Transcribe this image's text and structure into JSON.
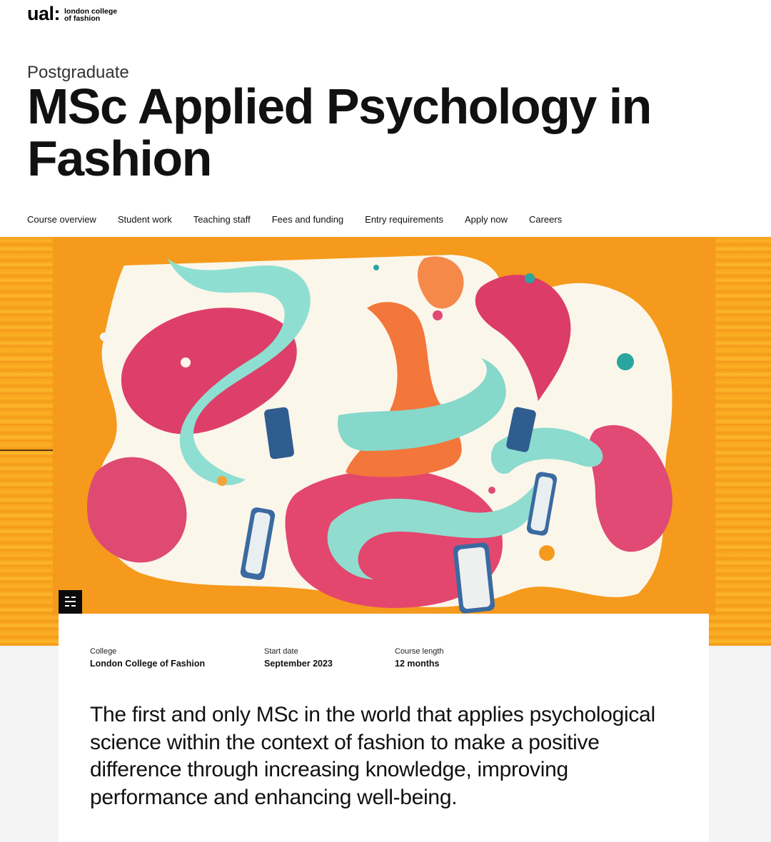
{
  "brand": {
    "mark": "ual:",
    "line1": "london college",
    "line2": "of fashion"
  },
  "header": {
    "kicker": "Postgraduate",
    "title": "MSc Applied Psychology in Fashion"
  },
  "nav": {
    "items": [
      "Course overview",
      "Student work",
      "Teaching staff",
      "Fees and funding",
      "Entry requirements",
      "Apply now",
      "Careers"
    ]
  },
  "hero": {
    "image_icon": "image-caption-icon",
    "colors": {
      "orange": "#f7a21e",
      "pink": "#e0456f",
      "teal": "#7fd8cc",
      "cream": "#fbf6ea",
      "blue": "#2f5d8f"
    }
  },
  "facts": {
    "college_label": "College",
    "college_value": "London College of Fashion",
    "start_label": "Start date",
    "start_value": "September 2023",
    "length_label": "Course length",
    "length_value": "12 months"
  },
  "intro": "The first and only MSc in the world that applies psychological science within the context of fashion to make a positive difference through increasing knowledge, improving performance and enhancing well-being."
}
